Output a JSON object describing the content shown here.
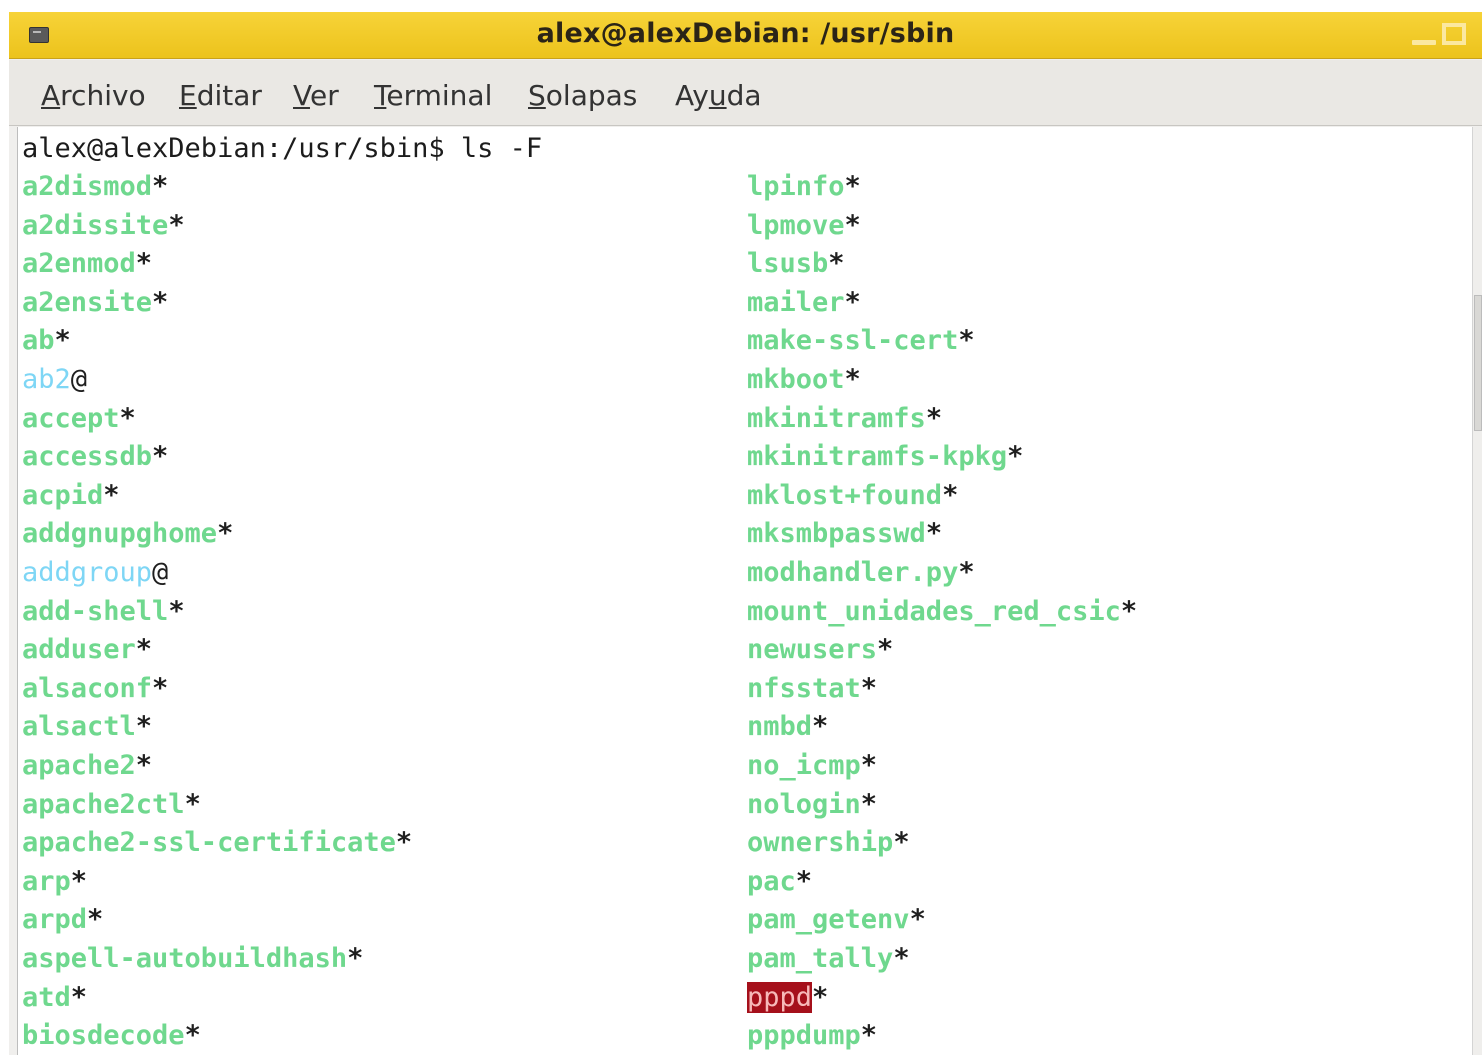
{
  "window": {
    "title": "alex@alexDebian: /usr/sbin"
  },
  "menubar": {
    "items": [
      {
        "label_ul": "A",
        "label_rest": "rchivo"
      },
      {
        "label_ul": "E",
        "label_rest": "ditar"
      },
      {
        "label_ul": "V",
        "label_rest": "er"
      },
      {
        "label_ul": "T",
        "label_rest": "erminal"
      },
      {
        "label_ul": "S",
        "label_rest": "olapas"
      },
      {
        "label_pre": "Ay",
        "label_ul": "u",
        "label_rest": "da"
      }
    ]
  },
  "terminal": {
    "prompt": "alex@alexDebian:/usr/sbin$ ls -F",
    "colors": {
      "executable": "#6fd88e",
      "symlink": "#7ed6f5",
      "setuid_bg": "#a5101b",
      "text": "#1c1c1c"
    },
    "left_column": [
      {
        "name": "a2dismod",
        "suffix": "*",
        "kind": "exec"
      },
      {
        "name": "a2dissite",
        "suffix": "*",
        "kind": "exec"
      },
      {
        "name": "a2enmod",
        "suffix": "*",
        "kind": "exec"
      },
      {
        "name": "a2ensite",
        "suffix": "*",
        "kind": "exec"
      },
      {
        "name": "ab",
        "suffix": "*",
        "kind": "exec"
      },
      {
        "name": "ab2",
        "suffix": "@",
        "kind": "link"
      },
      {
        "name": "accept",
        "suffix": "*",
        "kind": "exec"
      },
      {
        "name": "accessdb",
        "suffix": "*",
        "kind": "exec"
      },
      {
        "name": "acpid",
        "suffix": "*",
        "kind": "exec"
      },
      {
        "name": "addgnupghome",
        "suffix": "*",
        "kind": "exec"
      },
      {
        "name": "addgroup",
        "suffix": "@",
        "kind": "link"
      },
      {
        "name": "add-shell",
        "suffix": "*",
        "kind": "exec"
      },
      {
        "name": "adduser",
        "suffix": "*",
        "kind": "exec"
      },
      {
        "name": "alsaconf",
        "suffix": "*",
        "kind": "exec"
      },
      {
        "name": "alsactl",
        "suffix": "*",
        "kind": "exec"
      },
      {
        "name": "apache2",
        "suffix": "*",
        "kind": "exec"
      },
      {
        "name": "apache2ctl",
        "suffix": "*",
        "kind": "exec"
      },
      {
        "name": "apache2-ssl-certificate",
        "suffix": "*",
        "kind": "exec"
      },
      {
        "name": "arp",
        "suffix": "*",
        "kind": "exec"
      },
      {
        "name": "arpd",
        "suffix": "*",
        "kind": "exec"
      },
      {
        "name": "aspell-autobuildhash",
        "suffix": "*",
        "kind": "exec"
      },
      {
        "name": "atd",
        "suffix": "*",
        "kind": "exec"
      },
      {
        "name": "biosdecode",
        "suffix": "*",
        "kind": "exec"
      }
    ],
    "right_column": [
      {
        "name": "lpinfo",
        "suffix": "*",
        "kind": "exec"
      },
      {
        "name": "lpmove",
        "suffix": "*",
        "kind": "exec"
      },
      {
        "name": "lsusb",
        "suffix": "*",
        "kind": "exec"
      },
      {
        "name": "mailer",
        "suffix": "*",
        "kind": "exec"
      },
      {
        "name": "make-ssl-cert",
        "suffix": "*",
        "kind": "exec"
      },
      {
        "name": "mkboot",
        "suffix": "*",
        "kind": "exec"
      },
      {
        "name": "mkinitramfs",
        "suffix": "*",
        "kind": "exec"
      },
      {
        "name": "mkinitramfs-kpkg",
        "suffix": "*",
        "kind": "exec"
      },
      {
        "name": "mklost+found",
        "suffix": "*",
        "kind": "exec"
      },
      {
        "name": "mksmbpasswd",
        "suffix": "*",
        "kind": "exec"
      },
      {
        "name": "modhandler.py",
        "suffix": "*",
        "kind": "exec"
      },
      {
        "name": "mount_unidades_red_csic",
        "suffix": "*",
        "kind": "exec"
      },
      {
        "name": "newusers",
        "suffix": "*",
        "kind": "exec"
      },
      {
        "name": "nfsstat",
        "suffix": "*",
        "kind": "exec"
      },
      {
        "name": "nmbd",
        "suffix": "*",
        "kind": "exec"
      },
      {
        "name": "no_icmp",
        "suffix": "*",
        "kind": "exec"
      },
      {
        "name": "nologin",
        "suffix": "*",
        "kind": "exec"
      },
      {
        "name": "ownership",
        "suffix": "*",
        "kind": "exec"
      },
      {
        "name": "pac",
        "suffix": "*",
        "kind": "exec"
      },
      {
        "name": "pam_getenv",
        "suffix": "*",
        "kind": "exec"
      },
      {
        "name": "pam_tally",
        "suffix": "*",
        "kind": "exec"
      },
      {
        "name": "pppd",
        "suffix": "*",
        "kind": "setuid"
      },
      {
        "name": "pppdump",
        "suffix": "*",
        "kind": "exec"
      }
    ]
  }
}
